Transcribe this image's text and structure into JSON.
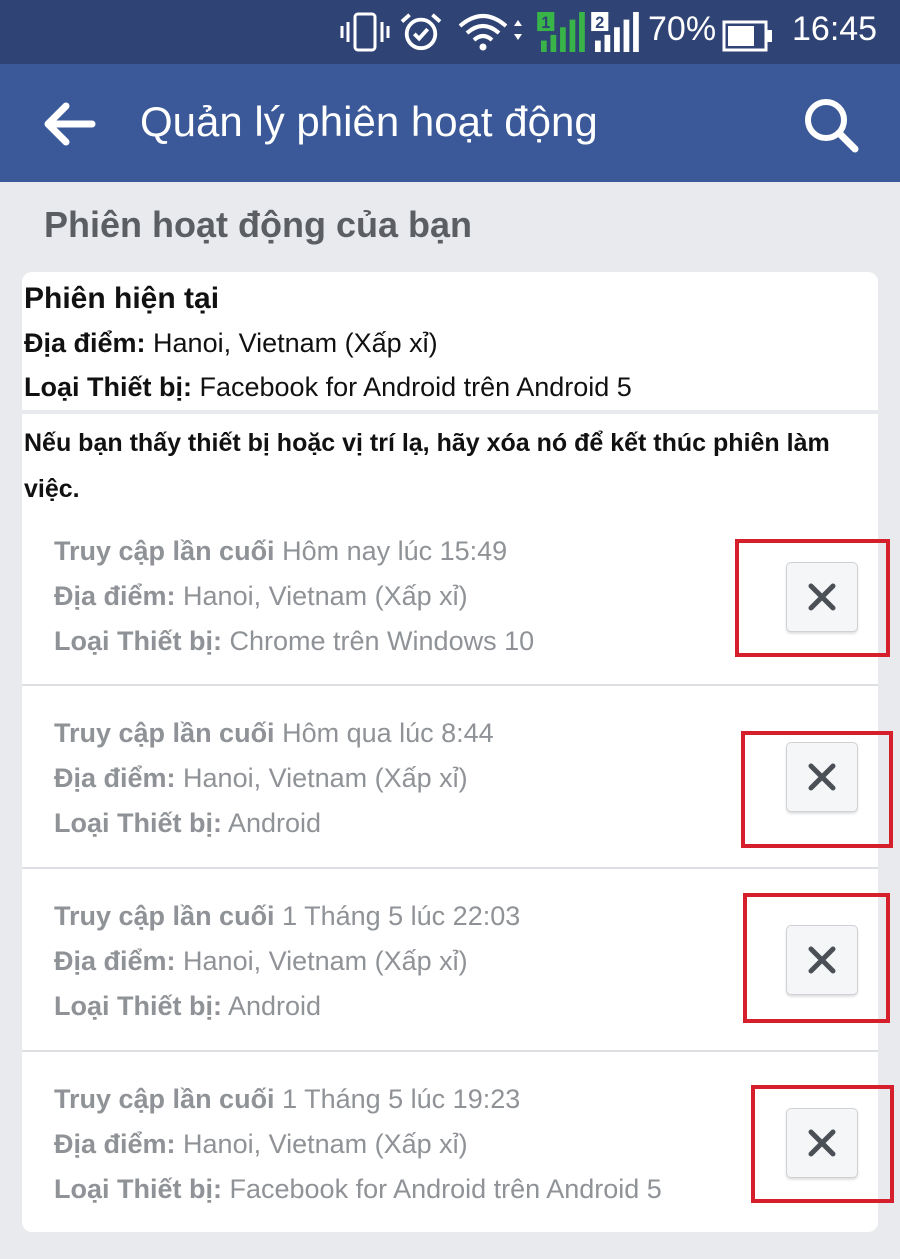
{
  "status_bar": {
    "battery": "70%",
    "time": "16:45",
    "sim1": "1",
    "sim2": "2",
    "icons": [
      "vibrate-icon",
      "alarm-icon",
      "wifi-icon",
      "signal-sim1-icon",
      "signal-sim2-icon",
      "battery-icon"
    ]
  },
  "app_bar": {
    "title": "Quản lý phiên hoạt động",
    "back_icon": "arrow-left-icon",
    "search_icon": "search-icon"
  },
  "section_title": "Phiên hoạt động của bạn",
  "current": {
    "title": "Phiên hiện tại",
    "location_label": "Địa điểm:",
    "location_value": " Hanoi, Vietnam (Xấp xỉ)",
    "device_label": "Loại Thiết bị:",
    "device_value": " Facebook for Android trên Android 5"
  },
  "warning": "Nếu bạn thấy thiết bị hoặc vị trí lạ, hãy xóa nó để kết thúc phiên làm việc.",
  "sessions": [
    {
      "access_label": "Truy cập lần cuối",
      "access_value": " Hôm nay lúc 15:49",
      "location_label": "Địa điểm:",
      "location_value": " Hanoi, Vietnam (Xấp xỉ)",
      "device_label": "Loại Thiết bị:",
      "device_value": " Chrome trên Windows 10"
    },
    {
      "access_label": "Truy cập lần cuối",
      "access_value": " Hôm qua lúc 8:44",
      "location_label": "Địa điểm:",
      "location_value": " Hanoi, Vietnam (Xấp xỉ)",
      "device_label": "Loại Thiết bị:",
      "device_value": " Android"
    },
    {
      "access_label": "Truy cập lần cuối",
      "access_value": " 1 Tháng 5 lúc 22:03",
      "location_label": "Địa điểm:",
      "location_value": " Hanoi, Vietnam (Xấp xỉ)",
      "device_label": "Loại Thiết bị:",
      "device_value": " Android"
    },
    {
      "access_label": "Truy cập lần cuối",
      "access_value": " 1 Tháng 5 lúc 19:23",
      "location_label": "Địa điểm:",
      "location_value": " Hanoi, Vietnam (Xấp xỉ)",
      "device_label": "Loại Thiết bị:",
      "device_value": " Facebook for Android trên Android 5"
    }
  ],
  "colors": {
    "status_bar": "#2f4474",
    "app_bar": "#3b5998",
    "page_background": "#e9eaed",
    "highlight": "#d51f2a",
    "muted_text": "#8f9296"
  }
}
